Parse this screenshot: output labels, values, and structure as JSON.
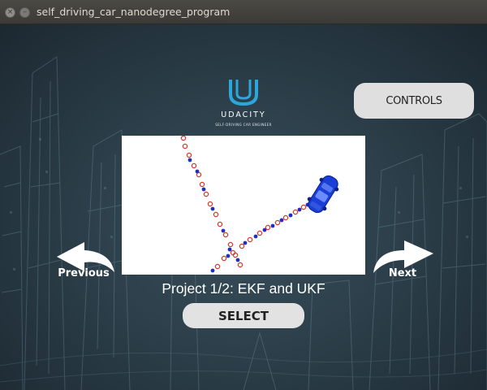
{
  "window": {
    "title": "self_driving_car_nanodegree_program",
    "close_glyph": "×",
    "minimize_glyph": "–"
  },
  "brand": {
    "name": "UDACITY",
    "tagline": "SELF-DRIVING CAR ENGINEER",
    "color": "#2aa8dc"
  },
  "controls": {
    "label": "CONTROLS"
  },
  "nav": {
    "previous_label": "Previous",
    "next_label": "Next"
  },
  "project": {
    "title": "Project 1/2: EKF and UKF",
    "select_label": "SELECT"
  },
  "colors": {
    "marker_red": "#d93a2b",
    "marker_blue": "#1f2fc4",
    "car_blue": "#1a3fd6"
  }
}
